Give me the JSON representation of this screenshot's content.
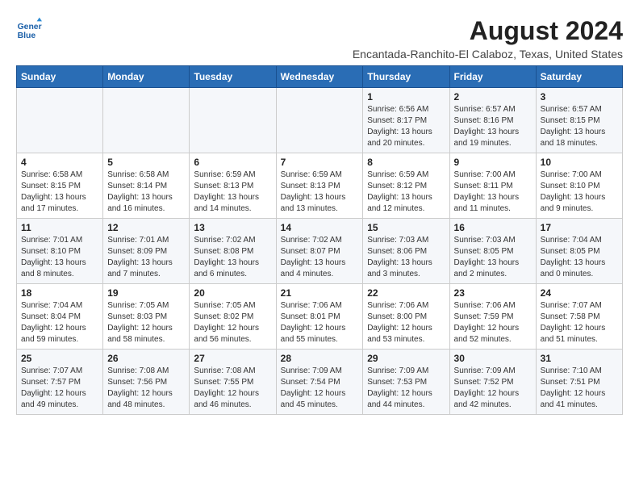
{
  "header": {
    "logo_line1": "General",
    "logo_line2": "Blue",
    "main_title": "August 2024",
    "subtitle": "Encantada-Ranchito-El Calaboz, Texas, United States"
  },
  "weekdays": [
    "Sunday",
    "Monday",
    "Tuesday",
    "Wednesday",
    "Thursday",
    "Friday",
    "Saturday"
  ],
  "weeks": [
    [
      {
        "day": "",
        "info": ""
      },
      {
        "day": "",
        "info": ""
      },
      {
        "day": "",
        "info": ""
      },
      {
        "day": "",
        "info": ""
      },
      {
        "day": "1",
        "info": "Sunrise: 6:56 AM\nSunset: 8:17 PM\nDaylight: 13 hours\nand 20 minutes."
      },
      {
        "day": "2",
        "info": "Sunrise: 6:57 AM\nSunset: 8:16 PM\nDaylight: 13 hours\nand 19 minutes."
      },
      {
        "day": "3",
        "info": "Sunrise: 6:57 AM\nSunset: 8:15 PM\nDaylight: 13 hours\nand 18 minutes."
      }
    ],
    [
      {
        "day": "4",
        "info": "Sunrise: 6:58 AM\nSunset: 8:15 PM\nDaylight: 13 hours\nand 17 minutes."
      },
      {
        "day": "5",
        "info": "Sunrise: 6:58 AM\nSunset: 8:14 PM\nDaylight: 13 hours\nand 16 minutes."
      },
      {
        "day": "6",
        "info": "Sunrise: 6:59 AM\nSunset: 8:13 PM\nDaylight: 13 hours\nand 14 minutes."
      },
      {
        "day": "7",
        "info": "Sunrise: 6:59 AM\nSunset: 8:13 PM\nDaylight: 13 hours\nand 13 minutes."
      },
      {
        "day": "8",
        "info": "Sunrise: 6:59 AM\nSunset: 8:12 PM\nDaylight: 13 hours\nand 12 minutes."
      },
      {
        "day": "9",
        "info": "Sunrise: 7:00 AM\nSunset: 8:11 PM\nDaylight: 13 hours\nand 11 minutes."
      },
      {
        "day": "10",
        "info": "Sunrise: 7:00 AM\nSunset: 8:10 PM\nDaylight: 13 hours\nand 9 minutes."
      }
    ],
    [
      {
        "day": "11",
        "info": "Sunrise: 7:01 AM\nSunset: 8:10 PM\nDaylight: 13 hours\nand 8 minutes."
      },
      {
        "day": "12",
        "info": "Sunrise: 7:01 AM\nSunset: 8:09 PM\nDaylight: 13 hours\nand 7 minutes."
      },
      {
        "day": "13",
        "info": "Sunrise: 7:02 AM\nSunset: 8:08 PM\nDaylight: 13 hours\nand 6 minutes."
      },
      {
        "day": "14",
        "info": "Sunrise: 7:02 AM\nSunset: 8:07 PM\nDaylight: 13 hours\nand 4 minutes."
      },
      {
        "day": "15",
        "info": "Sunrise: 7:03 AM\nSunset: 8:06 PM\nDaylight: 13 hours\nand 3 minutes."
      },
      {
        "day": "16",
        "info": "Sunrise: 7:03 AM\nSunset: 8:05 PM\nDaylight: 13 hours\nand 2 minutes."
      },
      {
        "day": "17",
        "info": "Sunrise: 7:04 AM\nSunset: 8:05 PM\nDaylight: 13 hours\nand 0 minutes."
      }
    ],
    [
      {
        "day": "18",
        "info": "Sunrise: 7:04 AM\nSunset: 8:04 PM\nDaylight: 12 hours\nand 59 minutes."
      },
      {
        "day": "19",
        "info": "Sunrise: 7:05 AM\nSunset: 8:03 PM\nDaylight: 12 hours\nand 58 minutes."
      },
      {
        "day": "20",
        "info": "Sunrise: 7:05 AM\nSunset: 8:02 PM\nDaylight: 12 hours\nand 56 minutes."
      },
      {
        "day": "21",
        "info": "Sunrise: 7:06 AM\nSunset: 8:01 PM\nDaylight: 12 hours\nand 55 minutes."
      },
      {
        "day": "22",
        "info": "Sunrise: 7:06 AM\nSunset: 8:00 PM\nDaylight: 12 hours\nand 53 minutes."
      },
      {
        "day": "23",
        "info": "Sunrise: 7:06 AM\nSunset: 7:59 PM\nDaylight: 12 hours\nand 52 minutes."
      },
      {
        "day": "24",
        "info": "Sunrise: 7:07 AM\nSunset: 7:58 PM\nDaylight: 12 hours\nand 51 minutes."
      }
    ],
    [
      {
        "day": "25",
        "info": "Sunrise: 7:07 AM\nSunset: 7:57 PM\nDaylight: 12 hours\nand 49 minutes."
      },
      {
        "day": "26",
        "info": "Sunrise: 7:08 AM\nSunset: 7:56 PM\nDaylight: 12 hours\nand 48 minutes."
      },
      {
        "day": "27",
        "info": "Sunrise: 7:08 AM\nSunset: 7:55 PM\nDaylight: 12 hours\nand 46 minutes."
      },
      {
        "day": "28",
        "info": "Sunrise: 7:09 AM\nSunset: 7:54 PM\nDaylight: 12 hours\nand 45 minutes."
      },
      {
        "day": "29",
        "info": "Sunrise: 7:09 AM\nSunset: 7:53 PM\nDaylight: 12 hours\nand 44 minutes."
      },
      {
        "day": "30",
        "info": "Sunrise: 7:09 AM\nSunset: 7:52 PM\nDaylight: 12 hours\nand 42 minutes."
      },
      {
        "day": "31",
        "info": "Sunrise: 7:10 AM\nSunset: 7:51 PM\nDaylight: 12 hours\nand 41 minutes."
      }
    ]
  ]
}
